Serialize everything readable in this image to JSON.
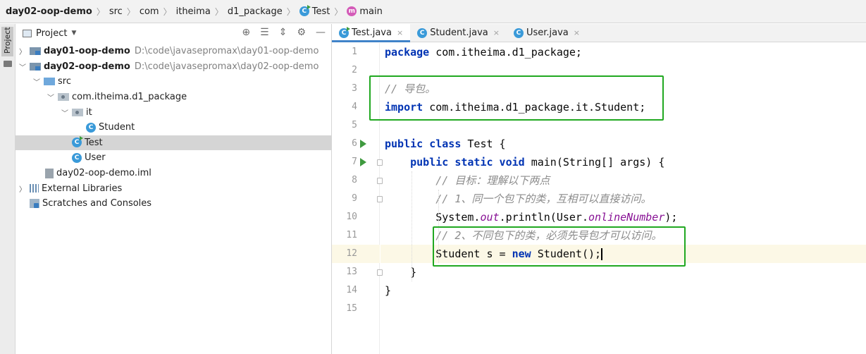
{
  "breadcrumb": {
    "items": [
      {
        "label": "day02-oop-demo",
        "icon": null
      },
      {
        "label": "src",
        "icon": null
      },
      {
        "label": "com",
        "icon": null
      },
      {
        "label": "itheima",
        "icon": null
      },
      {
        "label": "d1_package",
        "icon": null
      },
      {
        "label": "Test",
        "icon": "class-run-icon"
      },
      {
        "label": "main",
        "icon": "method-icon"
      }
    ],
    "separator": "〉",
    "class_letter": "C",
    "method_letter": "m"
  },
  "side_strip": {
    "tab_label": "Project"
  },
  "project_panel": {
    "title": "Project",
    "dropdown_arrow": "▼",
    "tools": [
      "⊕",
      "☰",
      "⇕",
      "⚙",
      "—"
    ],
    "tree": [
      {
        "indent": 0,
        "chevron": "〉",
        "icon": "module-folder",
        "name": "day01-oop-demo",
        "bold": true,
        "path": "D:\\code\\javasepromax\\day01-oop-demo"
      },
      {
        "indent": 0,
        "chevron": "﹀",
        "icon": "module-folder",
        "name": "day02-oop-demo",
        "bold": true,
        "path": "D:\\code\\javasepromax\\day02-oop-demo"
      },
      {
        "indent": 1,
        "chevron": "﹀",
        "icon": "source-folder",
        "name": "src"
      },
      {
        "indent": 2,
        "chevron": "﹀",
        "icon": "package-folder",
        "name": "com.itheima.d1_package"
      },
      {
        "indent": 3,
        "chevron": "﹀",
        "icon": "package-folder",
        "name": "it"
      },
      {
        "indent": 4,
        "chevron": "",
        "icon": "class",
        "name": "Student"
      },
      {
        "indent": 3,
        "chevron": "",
        "icon": "class-run",
        "name": "Test",
        "selected": true
      },
      {
        "indent": 3,
        "chevron": "",
        "icon": "class",
        "name": "User"
      },
      {
        "indent": 1,
        "chevron": "",
        "icon": "iml-file",
        "name": "day02-oop-demo.iml"
      },
      {
        "indent": 0,
        "chevron": "〉",
        "icon": "libraries",
        "name": "External Libraries"
      },
      {
        "indent": 0,
        "chevron": "",
        "icon": "scratches",
        "name": "Scratches and Consoles"
      }
    ]
  },
  "editor": {
    "tabs": [
      {
        "label": "Test.java",
        "icon": "class-run",
        "active": true
      },
      {
        "label": "Student.java",
        "icon": "class",
        "active": false
      },
      {
        "label": "User.java",
        "icon": "class",
        "active": false
      }
    ],
    "close_glyph": "×",
    "current_line": 12,
    "lines": [
      {
        "n": "1",
        "tokens": [
          {
            "t": "package ",
            "c": "kw"
          },
          {
            "t": "com.itheima.d1_package;",
            "c": ""
          }
        ]
      },
      {
        "n": "2",
        "tokens": []
      },
      {
        "n": "3",
        "tokens": [
          {
            "t": "// 导包。",
            "c": "cm"
          }
        ]
      },
      {
        "n": "4",
        "tokens": [
          {
            "t": "import ",
            "c": "kw"
          },
          {
            "t": "com.itheima.d1_package.it.Student;",
            "c": ""
          }
        ]
      },
      {
        "n": "5",
        "tokens": []
      },
      {
        "n": "6",
        "tokens": [
          {
            "t": "public class ",
            "c": "kw"
          },
          {
            "t": "Test {",
            "c": ""
          }
        ]
      },
      {
        "n": "7",
        "tokens": [
          {
            "t": "    ",
            "c": ""
          },
          {
            "t": "public static void ",
            "c": "kw"
          },
          {
            "t": "main(String[] args) {",
            "c": ""
          }
        ]
      },
      {
        "n": "8",
        "tokens": [
          {
            "t": "        ",
            "c": ""
          },
          {
            "t": "// 目标：理解以下两点",
            "c": "cm"
          }
        ]
      },
      {
        "n": "9",
        "tokens": [
          {
            "t": "        ",
            "c": ""
          },
          {
            "t": "// 1、同一个包下的类，互相可以直接访问。",
            "c": "cm"
          }
        ]
      },
      {
        "n": "10",
        "tokens": [
          {
            "t": "        System.",
            "c": ""
          },
          {
            "t": "out",
            "c": "fld"
          },
          {
            "t": ".println(User.",
            "c": ""
          },
          {
            "t": "onlineNumber",
            "c": "fld"
          },
          {
            "t": ");",
            "c": ""
          }
        ]
      },
      {
        "n": "11",
        "tokens": [
          {
            "t": "        ",
            "c": ""
          },
          {
            "t": "// 2、不同包下的类，必须先导包才可以访问。",
            "c": "cm"
          }
        ]
      },
      {
        "n": "12",
        "tokens": [
          {
            "t": "        Student s = ",
            "c": ""
          },
          {
            "t": "new ",
            "c": "kw"
          },
          {
            "t": "Student();",
            "c": ""
          }
        ],
        "caret": true
      },
      {
        "n": "13",
        "tokens": [
          {
            "t": "    }",
            "c": ""
          }
        ]
      },
      {
        "n": "14",
        "tokens": [
          {
            "t": "}",
            "c": ""
          }
        ]
      },
      {
        "n": "15",
        "tokens": []
      }
    ],
    "run_lines": [
      6,
      7
    ],
    "fold_lines": [
      7,
      8,
      9,
      13
    ],
    "highlight_color": "#21a821"
  }
}
